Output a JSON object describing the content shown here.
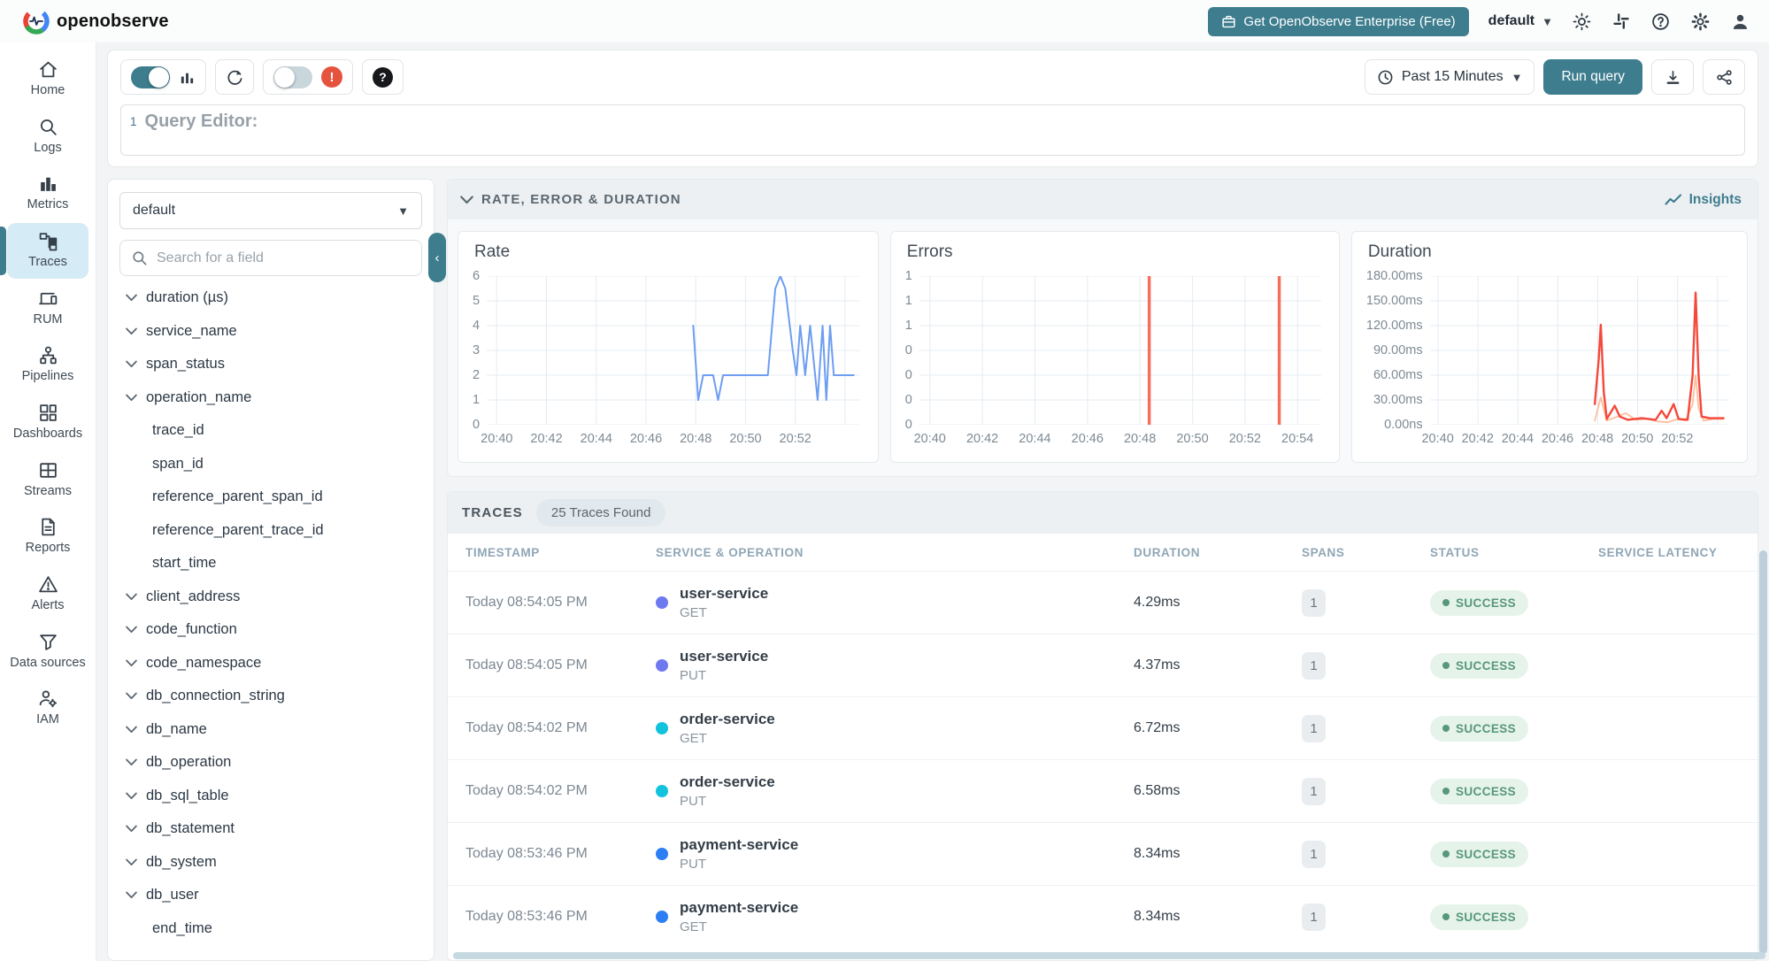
{
  "colors": {
    "accent_teal": "#3d7d8e",
    "active_nav_bg": "#d5ebf6",
    "success_bg": "#e6f3ea",
    "success_text": "#57977b",
    "rate_line": "#6d9ef1",
    "error_bar": "#f3705f",
    "duration_p99": "#f4483b",
    "duration_p50": "#ffbd9a"
  },
  "header": {
    "brand": "openobserve",
    "enterprise_button": "Get OpenObserve Enterprise (Free)",
    "org_selector": "default"
  },
  "sidebar": {
    "items": [
      {
        "label": "Home"
      },
      {
        "label": "Logs"
      },
      {
        "label": "Metrics"
      },
      {
        "label": "Traces",
        "active": true
      },
      {
        "label": "RUM"
      },
      {
        "label": "Pipelines"
      },
      {
        "label": "Dashboards"
      },
      {
        "label": "Streams"
      },
      {
        "label": "Reports"
      },
      {
        "label": "Alerts"
      },
      {
        "label": "Data sources"
      },
      {
        "label": "IAM"
      }
    ]
  },
  "toolbar": {
    "time_range": "Past 15 Minutes",
    "run_query": "Run query"
  },
  "query_editor": {
    "line_number": "1",
    "placeholder": "Query Editor:"
  },
  "fields_panel": {
    "stream_selector": "default",
    "search_placeholder": "Search for a field",
    "fields": [
      {
        "label": "duration (µs)"
      },
      {
        "label": "service_name"
      },
      {
        "label": "span_status"
      },
      {
        "label": "operation_name"
      },
      {
        "label": "trace_id",
        "indent": true
      },
      {
        "label": "span_id",
        "indent": true
      },
      {
        "label": "reference_parent_span_id",
        "indent": true
      },
      {
        "label": "reference_parent_trace_id",
        "indent": true
      },
      {
        "label": "start_time",
        "indent": true
      },
      {
        "label": "client_address"
      },
      {
        "label": "code_function"
      },
      {
        "label": "code_namespace"
      },
      {
        "label": "db_connection_string"
      },
      {
        "label": "db_name"
      },
      {
        "label": "db_operation"
      },
      {
        "label": "db_sql_table"
      },
      {
        "label": "db_statement"
      },
      {
        "label": "db_system"
      },
      {
        "label": "db_user"
      },
      {
        "label": "end_time",
        "indent": true
      }
    ]
  },
  "red_section": {
    "title": "RATE, ERROR & DURATION",
    "insights_label": "Insights"
  },
  "chart_data": [
    {
      "type": "line",
      "title": "Rate",
      "x_min": -0.4,
      "x_max": 14.6,
      "x_grid": [
        0,
        2,
        4,
        6,
        8,
        10,
        12,
        14
      ],
      "x_ticks": [
        0,
        2,
        4,
        6,
        8,
        10,
        12
      ],
      "x_tick_labels": [
        "20:40",
        "20:42",
        "20:44",
        "20:46",
        "20:48",
        "20:50",
        "20:52"
      ],
      "y_min": 0,
      "y_max": 6,
      "y_tick_labels": [
        "6",
        "5",
        "4",
        "3",
        "2",
        "1",
        "0"
      ],
      "series": [
        {
          "name": "rate",
          "kind": "line",
          "color": "#6d9ef1",
          "width": 2,
          "points": [
            [
              7.9,
              4
            ],
            [
              8.1,
              1
            ],
            [
              8.3,
              2
            ],
            [
              8.7,
              2
            ],
            [
              8.9,
              1
            ],
            [
              9.1,
              2
            ],
            [
              10.9,
              2
            ],
            [
              11.2,
              5.5
            ],
            [
              11.4,
              6
            ],
            [
              11.6,
              5.5
            ],
            [
              11.9,
              3
            ],
            [
              12.05,
              2
            ],
            [
              12.2,
              4
            ],
            [
              12.4,
              2
            ],
            [
              12.6,
              4
            ],
            [
              12.8,
              2
            ],
            [
              12.9,
              1
            ],
            [
              13.1,
              4
            ],
            [
              13.25,
              1
            ],
            [
              13.4,
              4
            ],
            [
              13.55,
              2
            ],
            [
              14.35,
              2
            ]
          ]
        }
      ]
    },
    {
      "type": "line",
      "title": "Errors",
      "x_min": -0.4,
      "x_max": 14.9,
      "x_grid": [
        0,
        2,
        4,
        6,
        8,
        10,
        12,
        14
      ],
      "x_ticks": [
        0,
        2,
        4,
        6,
        8,
        10,
        12,
        14
      ],
      "x_tick_labels": [
        "20:40",
        "20:42",
        "20:44",
        "20:46",
        "20:48",
        "20:50",
        "20:52",
        "20:54"
      ],
      "y_min": 0,
      "y_max": 1,
      "y_tick_labels": [
        "1",
        "1",
        "1",
        "0",
        "0",
        "0",
        "0"
      ],
      "series": [
        {
          "name": "errors",
          "kind": "vbar",
          "color": "#f3705f",
          "width": 3.5,
          "points": [
            [
              8.35,
              1
            ],
            [
              13.3,
              1
            ]
          ]
        }
      ]
    },
    {
      "type": "line",
      "title": "Duration",
      "x_min": -0.4,
      "x_max": 14.6,
      "x_grid": [
        0,
        2,
        4,
        6,
        8,
        10,
        12,
        14
      ],
      "x_ticks": [
        0,
        2,
        4,
        6,
        8,
        10,
        12
      ],
      "x_tick_labels": [
        "20:40",
        "20:42",
        "20:44",
        "20:46",
        "20:48",
        "20:50",
        "20:52"
      ],
      "y_min": 0,
      "y_max": 180,
      "y_tick_labels": [
        "180.00ms",
        "150.00ms",
        "120.00ms",
        "90.00ms",
        "60.00ms",
        "30.00ms",
        "0.00ns"
      ],
      "series": [
        {
          "name": "p50",
          "kind": "line",
          "color": "#ffbd9a",
          "width": 1.8,
          "points": [
            [
              7.85,
              5
            ],
            [
              8.15,
              33
            ],
            [
              8.45,
              5
            ],
            [
              9.0,
              10
            ],
            [
              9.4,
              14
            ],
            [
              9.9,
              6
            ],
            [
              10.5,
              7
            ],
            [
              11.0,
              4
            ],
            [
              11.5,
              3
            ],
            [
              12.0,
              7
            ],
            [
              12.4,
              5
            ],
            [
              12.75,
              25
            ],
            [
              12.9,
              60
            ],
            [
              13.05,
              20
            ],
            [
              13.3,
              5
            ],
            [
              13.8,
              7
            ],
            [
              14.3,
              7
            ]
          ]
        },
        {
          "name": "p99",
          "kind": "line",
          "color": "#f4483b",
          "width": 2.4,
          "points": [
            [
              7.85,
              25
            ],
            [
              8.05,
              80
            ],
            [
              8.15,
              121
            ],
            [
              8.3,
              40
            ],
            [
              8.45,
              7
            ],
            [
              8.85,
              23
            ],
            [
              9.1,
              10
            ],
            [
              9.5,
              6
            ],
            [
              10.2,
              8
            ],
            [
              10.9,
              6
            ],
            [
              11.2,
              17
            ],
            [
              11.45,
              8
            ],
            [
              11.8,
              25
            ],
            [
              12.05,
              7
            ],
            [
              12.5,
              6
            ],
            [
              12.75,
              60
            ],
            [
              12.9,
              160
            ],
            [
              13.05,
              60
            ],
            [
              13.2,
              10
            ],
            [
              13.6,
              8
            ],
            [
              14.3,
              8
            ]
          ]
        }
      ]
    }
  ],
  "traces_section": {
    "title": "TRACES",
    "badge": "25 Traces Found",
    "columns": [
      "TIMESTAMP",
      "SERVICE & OPERATION",
      "DURATION",
      "SPANS",
      "STATUS",
      "SERVICE LATENCY"
    ],
    "rows": [
      {
        "timestamp": "Today 08:54:05 PM",
        "service": "user-service",
        "operation": "GET",
        "duration": "4.29ms",
        "spans": "1",
        "status": "SUCCESS",
        "color": "#6e79f0"
      },
      {
        "timestamp": "Today 08:54:05 PM",
        "service": "user-service",
        "operation": "PUT",
        "duration": "4.37ms",
        "spans": "1",
        "status": "SUCCESS",
        "color": "#6e79f0"
      },
      {
        "timestamp": "Today 08:54:02 PM",
        "service": "order-service",
        "operation": "GET",
        "duration": "6.72ms",
        "spans": "1",
        "status": "SUCCESS",
        "color": "#12c3de"
      },
      {
        "timestamp": "Today 08:54:02 PM",
        "service": "order-service",
        "operation": "PUT",
        "duration": "6.58ms",
        "spans": "1",
        "status": "SUCCESS",
        "color": "#12c3de"
      },
      {
        "timestamp": "Today 08:53:46 PM",
        "service": "payment-service",
        "operation": "PUT",
        "duration": "8.34ms",
        "spans": "1",
        "status": "SUCCESS",
        "color": "#2c7ef5"
      },
      {
        "timestamp": "Today 08:53:46 PM",
        "service": "payment-service",
        "operation": "GET",
        "duration": "8.34ms",
        "spans": "1",
        "status": "SUCCESS",
        "color": "#2c7ef5"
      }
    ]
  }
}
